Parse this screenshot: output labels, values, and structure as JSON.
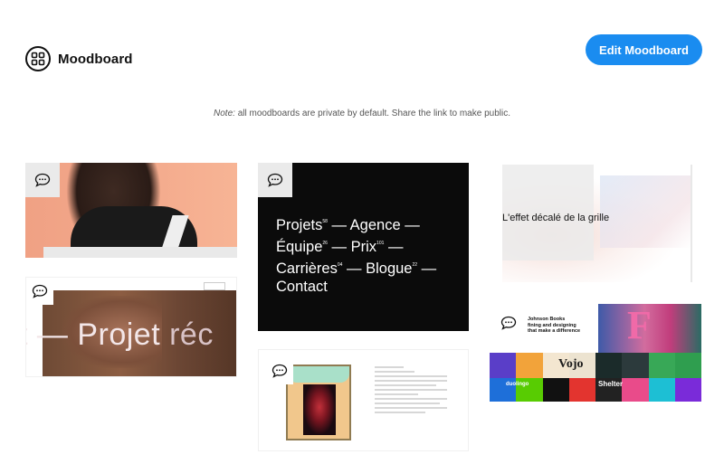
{
  "header": {
    "title": "Moodboard",
    "edit_label": "Edit Moodboard",
    "note_prefix": "Note:",
    "note_text": " all moodboards are private by default. Share the link to make public."
  },
  "colors": {
    "accent": "#1a8cf0",
    "text": "#111111",
    "muted": "#555555"
  },
  "tiles": {
    "t2_headline_a": "t — Projet ",
    "t2_headline_b": "réc",
    "t3_menu": [
      {
        "text": "Projets",
        "sup": "58",
        "rest": " — Agence —"
      },
      {
        "text": "Équipe",
        "sup": "26",
        "rest": " — Prix",
        "sup2": "101",
        "rest2": " —"
      },
      {
        "text": "Carrières",
        "sup": "04",
        "rest": " — Blogue",
        "sup2": "22",
        "rest2": " —"
      },
      {
        "text": "Contact"
      }
    ],
    "t5_label": "L'effet décalé de la grille",
    "t6_heading_1": "Johnson Books",
    "t6_heading_2": "fining and designing",
    "t6_heading_3": "that make a difference",
    "t6_vojo": "Vojo",
    "t6_duolingo": "duolingo",
    "t6_shelter": "Shelter"
  },
  "icons": {
    "brand": "grid-icon",
    "comment": "comment-icon"
  }
}
